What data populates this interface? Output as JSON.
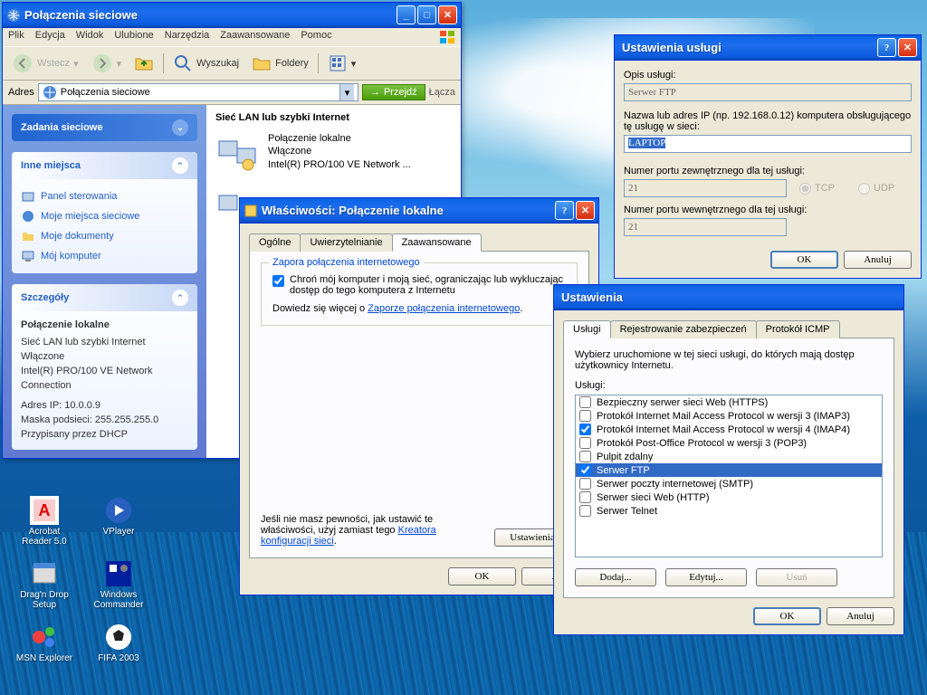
{
  "desktop": {
    "icons": [
      {
        "label": "Acrobat Reader 5.0"
      },
      {
        "label": "VPlayer"
      },
      {
        "label": "Drag'n Drop Setup"
      },
      {
        "label": "Windows Commander"
      },
      {
        "label": "MSN Explorer"
      },
      {
        "label": "FIFA 2003"
      }
    ]
  },
  "explorer": {
    "title": "Połączenia sieciowe",
    "menu": [
      "Plik",
      "Edycja",
      "Widok",
      "Ulubione",
      "Narzędzia",
      "Zaawansowane",
      "Pomoc"
    ],
    "toolbar": {
      "back": "Wstecz",
      "search": "Wyszukaj",
      "folders": "Foldery"
    },
    "address": {
      "label": "Adres",
      "value": "Połączenia sieciowe",
      "go": "Przejdź",
      "links": "Łącza"
    },
    "sidebar": {
      "tasks": {
        "title": "Zadania sieciowe"
      },
      "places": {
        "title": "Inne miejsca",
        "items": [
          "Panel sterowania",
          "Moje miejsca sieciowe",
          "Moje dokumenty",
          "Mój komputer"
        ]
      },
      "details": {
        "title": "Szczegóły",
        "name": "Połączenie lokalne",
        "type": "Sieć LAN lub szybki Internet",
        "status": "Włączone",
        "adapter": "Intel(R) PRO/100 VE Network Connection",
        "ip": "Adres IP: 10.0.0.9",
        "mask": "Maska podsieci: 255.255.255.0",
        "dhcp": "Przypisany przez DHCP"
      }
    },
    "content": {
      "header": "Sieć LAN lub szybki Internet",
      "item": {
        "name": "Połączenie lokalne",
        "status": "Włączone",
        "adapter": "Intel(R) PRO/100 VE Network ..."
      }
    }
  },
  "props": {
    "title": "Właściwości: Połączenie lokalne",
    "tabs": [
      "Ogólne",
      "Uwierzytelnianie",
      "Zaawansowane"
    ],
    "firewall": {
      "legend": "Zapora połączenia internetowego",
      "check": "Chroń mój komputer i moją sieć, ograniczając lub wykluczając dostęp do tego komputera z Internetu",
      "learn_pre": "Dowiedz się więcej o ",
      "learn_link": "Zaporze połączenia internetowego",
      "learn_post": "."
    },
    "note_pre": "Jeśli nie masz pewności, jak ustawić te właściwości, użyj zamiast tego ",
    "note_link": "Kreatora konfiguracji sieci",
    "note_post": ".",
    "settings_btn": "Ustawienia...",
    "ok": "OK",
    "cancel": "A"
  },
  "adv": {
    "title": "Ustawienia",
    "tabs": [
      "Usługi",
      "Rejestrowanie zabezpieczeń",
      "Protokół ICMP"
    ],
    "desc": "Wybierz uruchomione w tej sieci usługi, do których mają dostęp użytkownicy Internetu.",
    "list_label": "Usługi:",
    "services": [
      {
        "label": "Bezpieczny serwer sieci Web (HTTPS)",
        "checked": false
      },
      {
        "label": "Protokół Internet Mail Access Protocol w wersji 3 (IMAP3)",
        "checked": false
      },
      {
        "label": "Protokół Internet Mail Access Protocol w wersji 4 (IMAP4)",
        "checked": true
      },
      {
        "label": "Protokół Post-Office Protocol w wersji 3 (POP3)",
        "checked": false
      },
      {
        "label": "Pulpit zdalny",
        "checked": false
      },
      {
        "label": "Serwer FTP",
        "checked": true,
        "selected": true
      },
      {
        "label": "Serwer poczty internetowej (SMTP)",
        "checked": false
      },
      {
        "label": "Serwer sieci Web (HTTP)",
        "checked": false
      },
      {
        "label": "Serwer Telnet",
        "checked": false
      }
    ],
    "add": "Dodaj...",
    "edit": "Edytuj...",
    "delete": "Usuń",
    "ok": "OK",
    "cancel": "Anuluj"
  },
  "service": {
    "title": "Ustawienia usługi",
    "desc_label": "Opis usługi:",
    "desc_value": "Serwer FTP",
    "host_label": "Nazwa lub adres IP (np. 192.168.0.12) komputera obsługującego tę usługę w sieci:",
    "host_value": "LAPTOP",
    "ext_label": "Numer portu zewnętrznego dla tej usługi:",
    "ext_value": "21",
    "tcp": "TCP",
    "udp": "UDP",
    "int_label": "Numer portu wewnętrznego dla tej usługi:",
    "int_value": "21",
    "ok": "OK",
    "cancel": "Anuluj"
  }
}
